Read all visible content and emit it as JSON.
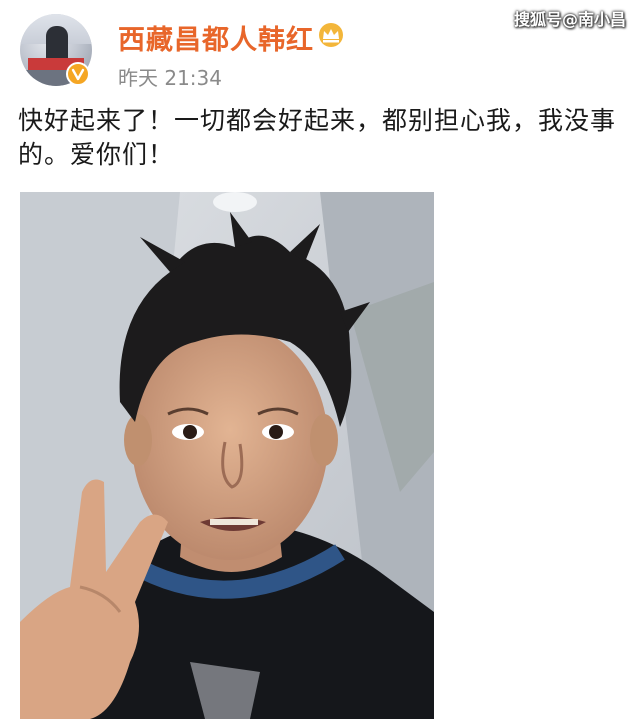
{
  "watermark": "搜狐号@南小昌",
  "post": {
    "author": {
      "name": "西藏昌都人韩红",
      "avatar_icon": "avatar-image",
      "verified_icon": "verified-badge-icon",
      "vip_icon": "crown-icon"
    },
    "timestamp": "昨天 21:34",
    "text": "快好起来了！一切都会好起来，都别担心我，我没事的。爱你们！",
    "photo_icon": "selfie-photo"
  },
  "colors": {
    "username": "#e8662a",
    "timestamp": "#8a8a8a",
    "badge": "#f5a623",
    "text": "#1a1a1a"
  }
}
